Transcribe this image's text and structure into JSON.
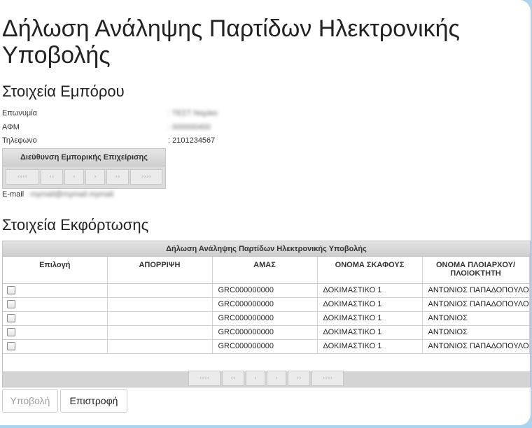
{
  "page": {
    "title": "Δήλωση Ανάληψης Παρτίδων Ηλεκτρονικής Υποβολής"
  },
  "merchant": {
    "heading": "Στοιχεία Εμπόρου",
    "fields": [
      {
        "label": "Επωνυμία",
        "value": ": ΤΕΣΤ Νομίκο"
      },
      {
        "label": "ΑΦΜ",
        "value": ": 000000400"
      },
      {
        "label": "Τηλεφωνο",
        "value": ": 2101234567"
      }
    ],
    "address_box": {
      "title": "Διεύθυνση Εμπορικής Επιχείρισης",
      "pager": [
        "‹‹‹‹",
        "‹‹",
        "‹",
        "›",
        "››",
        "››››"
      ]
    },
    "email": {
      "label": "E-mail",
      "value": ": mymail@mymail.mymail"
    }
  },
  "unloading": {
    "heading": "Στοιχεία Εκφόρτωσης",
    "grid": {
      "caption": "Δήλωση Ανάληψης Παρτίδων Ηλεκτρονικής Υποβολής",
      "columns": [
        "Επιλογή",
        "ΑΠΟΡΡΙΨΗ",
        "ΑΜΑΣ",
        "ΟΝΟΜΑ ΣΚΑΦΟΥΣ",
        "ΟΝΟΜΑ ΠΛΟΙΑΡΧΟΥ/ ΠΛΟΙΟΚΤΗΤΗ"
      ],
      "rows": [
        {
          "selected": false,
          "rejection": "",
          "amas": "GRC000000000",
          "vessel": "ΔΟΚΙΜΑΣΤΙΚΟ 1",
          "captain": "ΑΝΤΩΝΙΟΣ ΠΑΠΑΔΟΠΟΥΛΟΣ"
        },
        {
          "selected": false,
          "rejection": "",
          "amas": "GRC000000000",
          "vessel": "ΔΟΚΙΜΑΣΤΙΚΟ 1",
          "captain": "ΑΝΤΩΝΙΟΣ ΠΑΠΑΔΟΠΟΥΛΟΣ"
        },
        {
          "selected": false,
          "rejection": "",
          "amas": "GRC000000000",
          "vessel": "ΔΟΚΙΜΑΣΤΙΚΟ 1",
          "captain": "ΑΝΤΩΝΙΟΣ"
        },
        {
          "selected": false,
          "rejection": "",
          "amas": "GRC000000000",
          "vessel": "ΔΟΚΙΜΑΣΤΙΚΟ 1",
          "captain": "ΑΝΤΩΝΙΟΣ"
        },
        {
          "selected": false,
          "rejection": "",
          "amas": "GRC000000000",
          "vessel": "ΔΟΚΙΜΑΣΤΙΚΟ 1",
          "captain": "ΑΝΤΩΝΙΟΣ ΠΑΠΑΔΟΠΟΥΛΟΣ"
        }
      ],
      "pager": [
        "‹‹‹‹",
        "‹‹",
        "‹",
        "›",
        "››",
        "››››"
      ],
      "scroll": {
        "left_arrow": "◀",
        "right_arrow": "▶"
      }
    }
  },
  "actions": {
    "submit_label": "Υποβολή",
    "back_label": "Επιστροφή"
  }
}
